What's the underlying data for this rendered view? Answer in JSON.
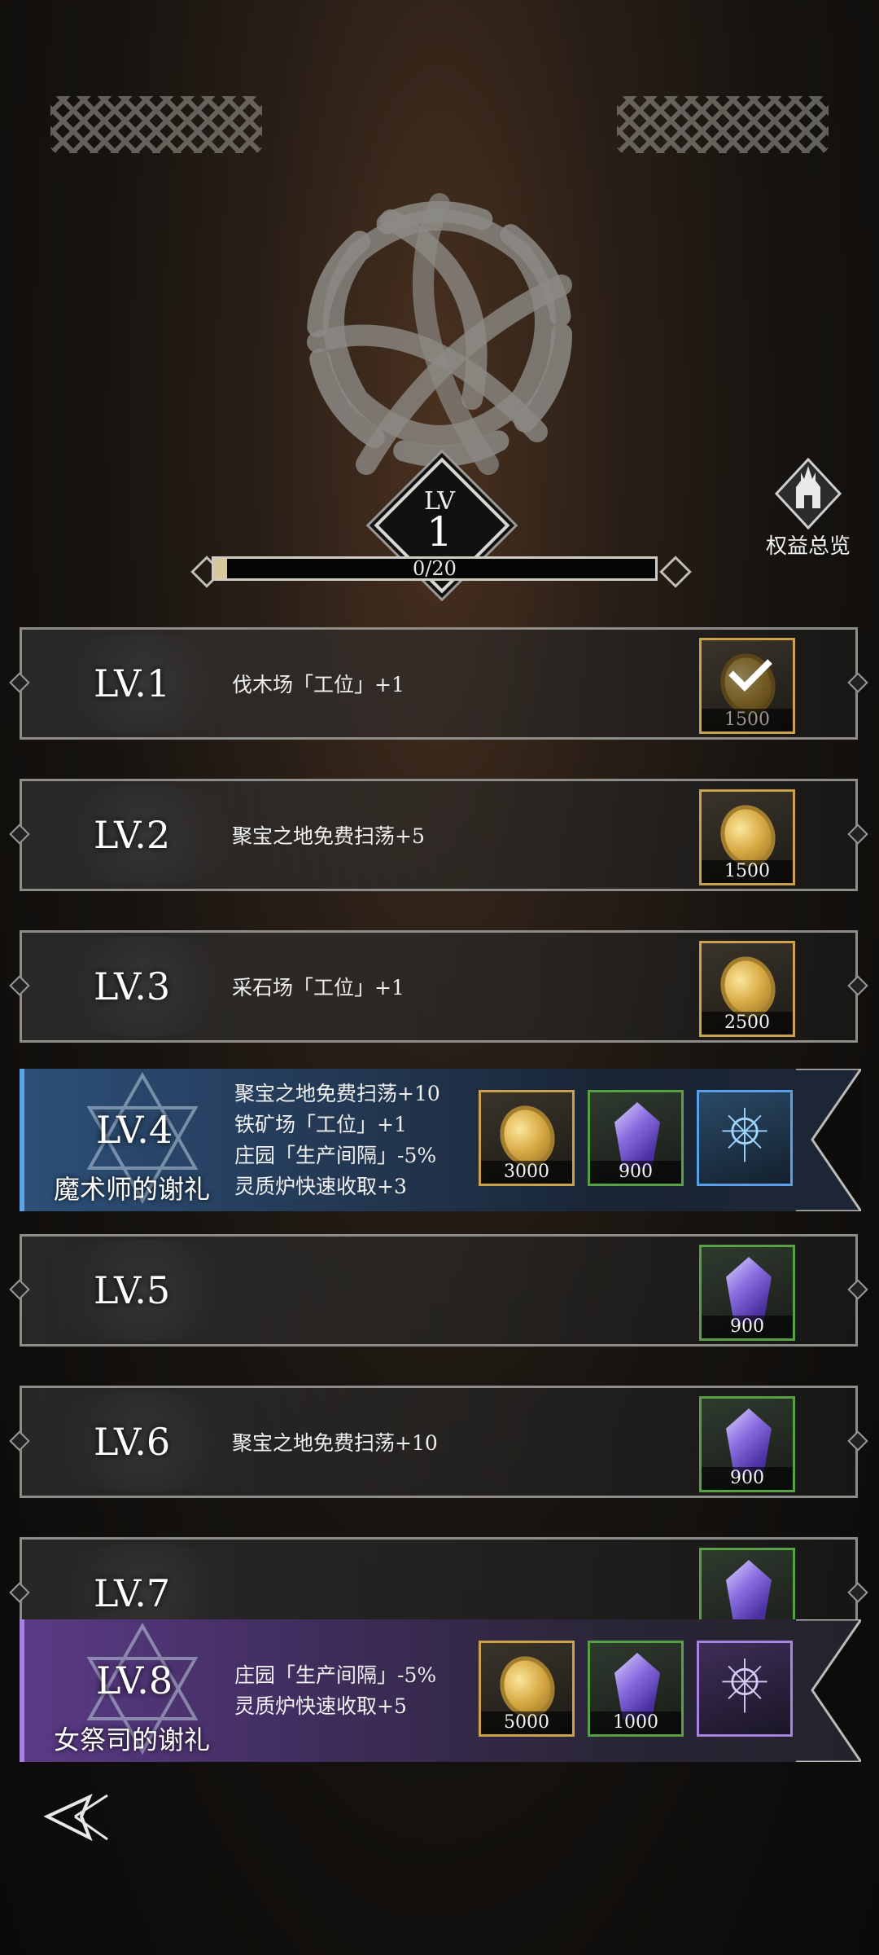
{
  "header": {
    "level_label": "LV",
    "level_value": "1",
    "progress_text": "0/20",
    "progress_fraction": 0.03,
    "overview_label": "权益总览"
  },
  "rows": [
    {
      "lv": "LV.1",
      "desc": [
        "伐木场「工位」+1"
      ],
      "rewards": [
        {
          "type": "coin",
          "amount": "1500",
          "claimed": true
        }
      ]
    },
    {
      "lv": "LV.2",
      "desc": [
        "聚宝之地免费扫荡+5"
      ],
      "rewards": [
        {
          "type": "coin",
          "amount": "1500"
        }
      ]
    },
    {
      "lv": "LV.3",
      "desc": [
        "采石场「工位」+1"
      ],
      "rewards": [
        {
          "type": "coin",
          "amount": "2500"
        }
      ]
    },
    {
      "lv": "LV.4",
      "title": "魔术师的谢礼",
      "desc": [
        "聚宝之地免费扫荡+10",
        "铁矿场「工位」+1",
        "庄园「生产间隔」-5%",
        "灵质炉快速收取+3"
      ],
      "rewards": [
        {
          "type": "coin",
          "amount": "3000"
        },
        {
          "type": "crystal",
          "amount": "900"
        },
        {
          "type": "glyph-blue",
          "amount": ""
        }
      ]
    },
    {
      "lv": "LV.5",
      "desc": [],
      "rewards": [
        {
          "type": "crystal",
          "amount": "900"
        }
      ]
    },
    {
      "lv": "LV.6",
      "desc": [
        "聚宝之地免费扫荡+10"
      ],
      "rewards": [
        {
          "type": "crystal",
          "amount": "900"
        }
      ]
    },
    {
      "lv": "LV.7",
      "desc": [],
      "rewards": [
        {
          "type": "crystal",
          "amount": ""
        }
      ]
    },
    {
      "lv": "LV.8",
      "title": "女祭司的谢礼",
      "desc": [
        "庄园「生产间隔」-5%",
        "灵质炉快速收取+5"
      ],
      "rewards": [
        {
          "type": "coin",
          "amount": "5000"
        },
        {
          "type": "crystal",
          "amount": "1000"
        },
        {
          "type": "glyph-purple",
          "amount": ""
        }
      ]
    }
  ],
  "colors": {
    "gold": "#c9a24a",
    "green": "#58a044",
    "blue": "#5aa0e6",
    "purple": "#a884e2"
  },
  "icons": {
    "overview": "castle-icon",
    "back": "back-arrow-icon",
    "emblem": "celtic-knot-emblem"
  }
}
